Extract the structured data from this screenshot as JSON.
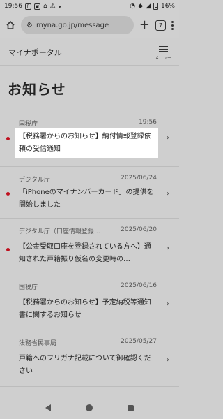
{
  "status_bar": {
    "time": "19:56",
    "battery": "16%"
  },
  "browser": {
    "url": "myna.go.jp/message",
    "tab_count": "7"
  },
  "site": {
    "title": "マイナポータル",
    "menu_label": "メニュー"
  },
  "page": {
    "title": "お知らせ"
  },
  "notices": [
    {
      "sender": "国税庁",
      "date": "19:56",
      "title": "【税務署からのお知らせ】納付情報登録依頼の受信通知",
      "unread": true,
      "highlighted": true
    },
    {
      "sender": "デジタル庁",
      "date": "2025/06/24",
      "title": "「iPhoneのマイナンバーカード」の提供を開始しました",
      "unread": true,
      "highlighted": false
    },
    {
      "sender": "デジタル庁（口座情報登録…",
      "date": "2025/06/20",
      "title": "【公金受取口座を登録されている方へ】通知された戸籍振り仮名の変更時の…",
      "unread": true,
      "highlighted": false
    },
    {
      "sender": "国税庁",
      "date": "2025/06/16",
      "title": "【税務署からのお知らせ】予定納税等通知書に関するお知らせ",
      "unread": false,
      "highlighted": false
    },
    {
      "sender": "法務省民事局",
      "date": "2025/05/27",
      "title": "戸籍へのフリガナ記載について御確認ください",
      "unread": false,
      "highlighted": false
    }
  ]
}
